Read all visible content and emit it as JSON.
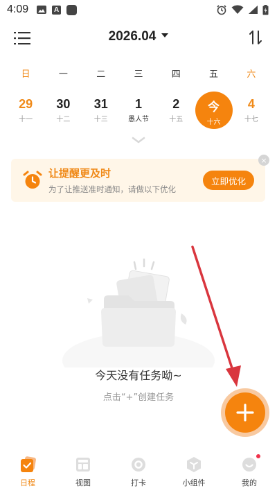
{
  "status_bar": {
    "time": "4:09",
    "left_icons": [
      "image-icon",
      "a-notification-icon",
      "app-square-icon"
    ],
    "right_icons": [
      "alarm-icon",
      "wifi-icon",
      "signal-icon",
      "battery-charging-icon"
    ]
  },
  "header": {
    "month_title": "2026.04",
    "menu_icon": "menu-icon",
    "sort_icon": "sort-icon"
  },
  "weekdays": [
    "日",
    "一",
    "二",
    "三",
    "四",
    "五",
    "六"
  ],
  "dates": [
    {
      "num": "29",
      "sub": "十一"
    },
    {
      "num": "30",
      "sub": "十二"
    },
    {
      "num": "31",
      "sub": "十三"
    },
    {
      "num": "1",
      "sub": "愚人节"
    },
    {
      "num": "2",
      "sub": "十五"
    },
    {
      "num": "今",
      "sub": "十六"
    },
    {
      "num": "4",
      "sub": "十七"
    }
  ],
  "banner": {
    "title": "让提醒更及时",
    "description": "为了让推送准时通知，请做以下优化",
    "button_label": "立即优化",
    "close_symbol": "×"
  },
  "empty_state": {
    "title": "今天没有任务呦~",
    "hint": "点击“+”创建任务"
  },
  "bottom_nav": [
    {
      "label": "日程",
      "icon": "calendar-check-icon"
    },
    {
      "label": "视图",
      "icon": "layout-icon"
    },
    {
      "label": "打卡",
      "icon": "checkin-icon"
    },
    {
      "label": "小组件",
      "icon": "widget-cube-icon"
    },
    {
      "label": "我的",
      "icon": "profile-smile-icon"
    }
  ],
  "colors": {
    "accent": "#F5840E",
    "weekend": "#F08A19",
    "banner_bg": "#FFF6E8",
    "arrow": "#D9363E",
    "badge": "#F0324B"
  }
}
